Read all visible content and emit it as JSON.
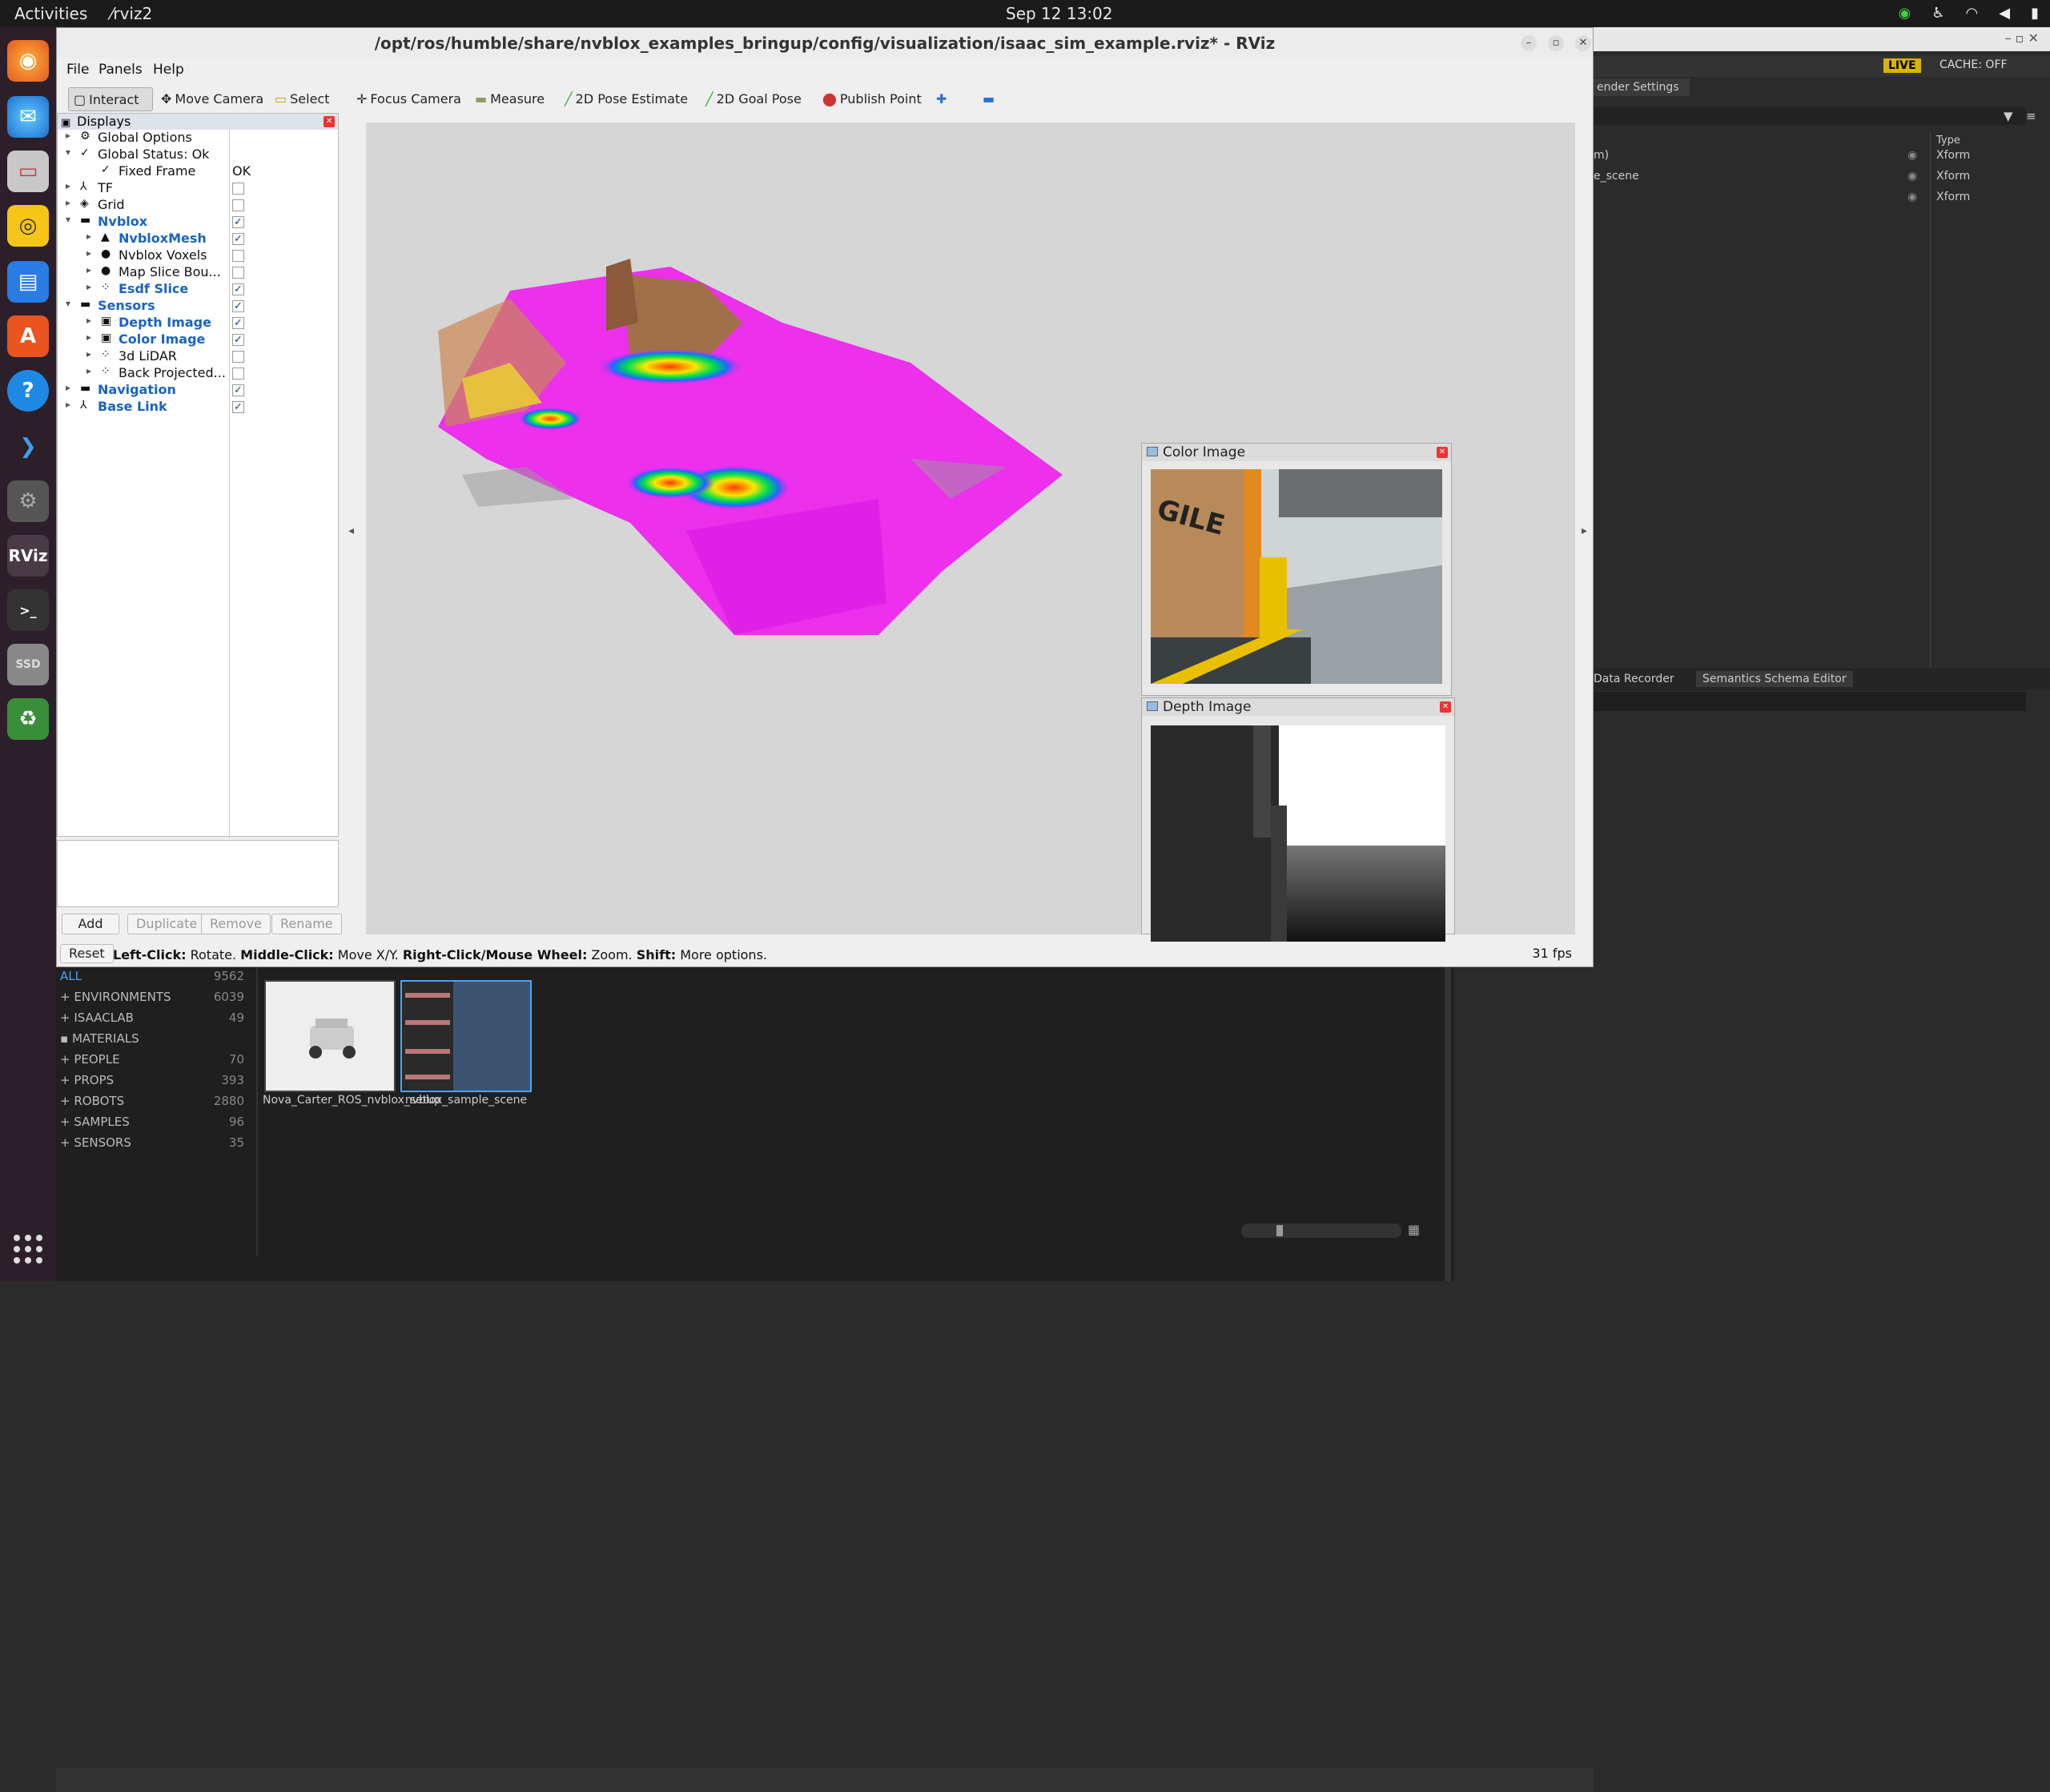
{
  "topbar": {
    "activities": "Activities",
    "app": "rviz2",
    "clock": "Sep 12  13:02"
  },
  "dock": {
    "icons": [
      "firefox-icon",
      "thunderbird-icon",
      "files-icon",
      "rhythmbox-icon",
      "writer-icon",
      "appcenter-icon",
      "help-icon",
      "vscode-icon",
      "isaac-icon",
      "rviz-icon",
      "terminal-icon",
      "ssd-icon",
      "trash-icon"
    ],
    "rviz_label": "RViz",
    "ssd_label": "SSD"
  },
  "isaac": {
    "render_settings": "ender Settings",
    "live": "LIVE",
    "cache": "CACHE: OFF",
    "type_header": "Type",
    "stage_rows": [
      {
        "name": "m)",
        "type": "Xform"
      },
      {
        "name": "e_scene",
        "type": "Xform"
      },
      {
        "name": "",
        "type": "Xform"
      }
    ],
    "tabs": [
      "Data Recorder",
      "Semantics Schema Editor"
    ],
    "categories": [
      {
        "name": "ALL",
        "count": "9562"
      },
      {
        "name": "ENVIRONMENTS",
        "count": "6039"
      },
      {
        "name": "ISAACLAB",
        "count": "49"
      },
      {
        "name": "MATERIALS",
        "count": ""
      },
      {
        "name": "PEOPLE",
        "count": "70"
      },
      {
        "name": "PROPS",
        "count": "393"
      },
      {
        "name": "ROBOTS",
        "count": "2880"
      },
      {
        "name": "SAMPLES",
        "count": "96"
      },
      {
        "name": "SENSORS",
        "count": "35"
      }
    ],
    "assets": [
      "Nova_Carter_ROS_nvblox_setup",
      "nvblox_sample_scene"
    ]
  },
  "rviz": {
    "title": "/opt/ros/humble/share/nvblox_examples_bringup/config/visualization/isaac_sim_example.rviz* - RViz",
    "menu": [
      "File",
      "Panels",
      "Help"
    ],
    "tools": [
      "Interact",
      "Move Camera",
      "Select",
      "Focus Camera",
      "Measure",
      "2D Pose Estimate",
      "2D Goal Pose",
      "Publish Point"
    ],
    "displays_title": "Displays",
    "tree": [
      {
        "label": "Global Options",
        "icon": "⚙",
        "indent": 0,
        "expand": "▸",
        "check": null,
        "bold": false
      },
      {
        "label": "Global Status: Ok",
        "icon": "✓",
        "indent": 0,
        "expand": "▾",
        "check": null,
        "bold": false
      },
      {
        "label": "Fixed Frame",
        "icon": "✓",
        "indent": 1,
        "expand": "",
        "check": null,
        "bold": false,
        "value": "OK"
      },
      {
        "label": "TF",
        "icon": "⅄",
        "indent": 0,
        "expand": "▸",
        "check": false,
        "bold": false
      },
      {
        "label": "Grid",
        "icon": "◈",
        "indent": 0,
        "expand": "▸",
        "check": false,
        "bold": false
      },
      {
        "label": "Nvblox",
        "icon": "▬",
        "indent": 0,
        "expand": "▾",
        "check": true,
        "bold": true
      },
      {
        "label": "NvbloxMesh",
        "icon": "▲",
        "indent": 1,
        "expand": "▸",
        "check": true,
        "bold": true
      },
      {
        "label": "Nvblox Voxels",
        "icon": "●",
        "indent": 1,
        "expand": "▸",
        "check": false,
        "bold": false
      },
      {
        "label": "Map Slice Bou...",
        "icon": "●",
        "indent": 1,
        "expand": "▸",
        "check": false,
        "bold": false
      },
      {
        "label": "Esdf Slice",
        "icon": "⁘",
        "indent": 1,
        "expand": "▸",
        "check": true,
        "bold": true
      },
      {
        "label": "Sensors",
        "icon": "▬",
        "indent": 0,
        "expand": "▾",
        "check": true,
        "bold": true
      },
      {
        "label": "Depth Image",
        "icon": "▣",
        "indent": 1,
        "expand": "▸",
        "check": true,
        "bold": true
      },
      {
        "label": "Color Image",
        "icon": "▣",
        "indent": 1,
        "expand": "▸",
        "check": true,
        "bold": true
      },
      {
        "label": "3d LiDAR",
        "icon": "⁘",
        "indent": 1,
        "expand": "▸",
        "check": false,
        "bold": false
      },
      {
        "label": "Back Projected...",
        "icon": "⁘",
        "indent": 1,
        "expand": "▸",
        "check": false,
        "bold": false
      },
      {
        "label": "Navigation",
        "icon": "▬",
        "indent": 0,
        "expand": "▸",
        "check": true,
        "bold": true
      },
      {
        "label": "Base Link",
        "icon": "⅄",
        "indent": 0,
        "expand": "▸",
        "check": true,
        "bold": true
      }
    ],
    "buttons": {
      "add": "Add",
      "duplicate": "Duplicate",
      "remove": "Remove",
      "rename": "Rename",
      "reset": "Reset"
    },
    "status": {
      "l1": "Left-Click:",
      "t1": " Rotate. ",
      "l2": "Middle-Click:",
      "t2": " Move X/Y. ",
      "l3": "Right-Click/Mouse Wheel:",
      "t3": " Zoom. ",
      "l4": "Shift:",
      "t4": " More options.",
      "fps": "31 fps"
    },
    "color_panel": "Color Image",
    "depth_panel": "Depth Image",
    "color_text": "GILE"
  }
}
